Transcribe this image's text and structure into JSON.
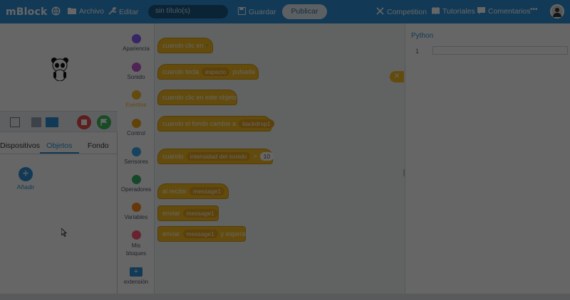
{
  "app": {
    "brand": "mBlock",
    "menu": {
      "archivo": "Archivo",
      "editar": "Editar",
      "guardar": "Guardar",
      "publicar": "Publicar",
      "competition": "Competition",
      "tutoriales": "Tutoriales",
      "comentarios": "Comentarios",
      "more": "•••"
    },
    "project_name": "sin título(s)"
  },
  "stage": {
    "tabs": [
      "Dispositivos",
      "Objetos",
      "Fondo"
    ],
    "active_tab": "Objetos",
    "add_label": "Añadir"
  },
  "categories": [
    {
      "label": "Apariencia",
      "color": "#8a5cff"
    },
    {
      "label": "Sonido",
      "color": "#c75ad8"
    },
    {
      "label": "Eventos",
      "color": "#f6bb21"
    },
    {
      "label": "Control",
      "color": "#f3a71b"
    },
    {
      "label": "Sensores",
      "color": "#38a9e8"
    },
    {
      "label": "Operadores",
      "color": "#36b36b"
    },
    {
      "label": "Variables",
      "color": "#ff8b1a"
    },
    {
      "label": "Mis bloques",
      "color": "#ff5b7a"
    },
    {
      "label": "extensión",
      "icon": "extension-icon"
    }
  ],
  "blocks": {
    "b1": {
      "text": "cuando clic en"
    },
    "b2": {
      "text": "cuando tecla",
      "dd": "espacio",
      "tail": "pulsada"
    },
    "b3": {
      "text": "cuando clic en este objeto"
    },
    "b4": {
      "text": "cuando el fondo cambie a",
      "dd": "backdrop1"
    },
    "b5": {
      "text": "cuando",
      "dd": "intensidad del sonido",
      "tail": ">",
      "val": "10"
    },
    "b6": {
      "text": "al recibir",
      "dd": "message1"
    },
    "b7": {
      "text": "enviar",
      "dd": "message1"
    },
    "b8": {
      "text": "enviar",
      "dd": "message1",
      "tail": "y esperar"
    }
  },
  "python": {
    "title": "Python",
    "line_no": "1"
  },
  "colors": {
    "topbar": "#2f92d8",
    "event_block": "#f6bb21",
    "overlay": "rgba(0,0,0,0.6)"
  }
}
